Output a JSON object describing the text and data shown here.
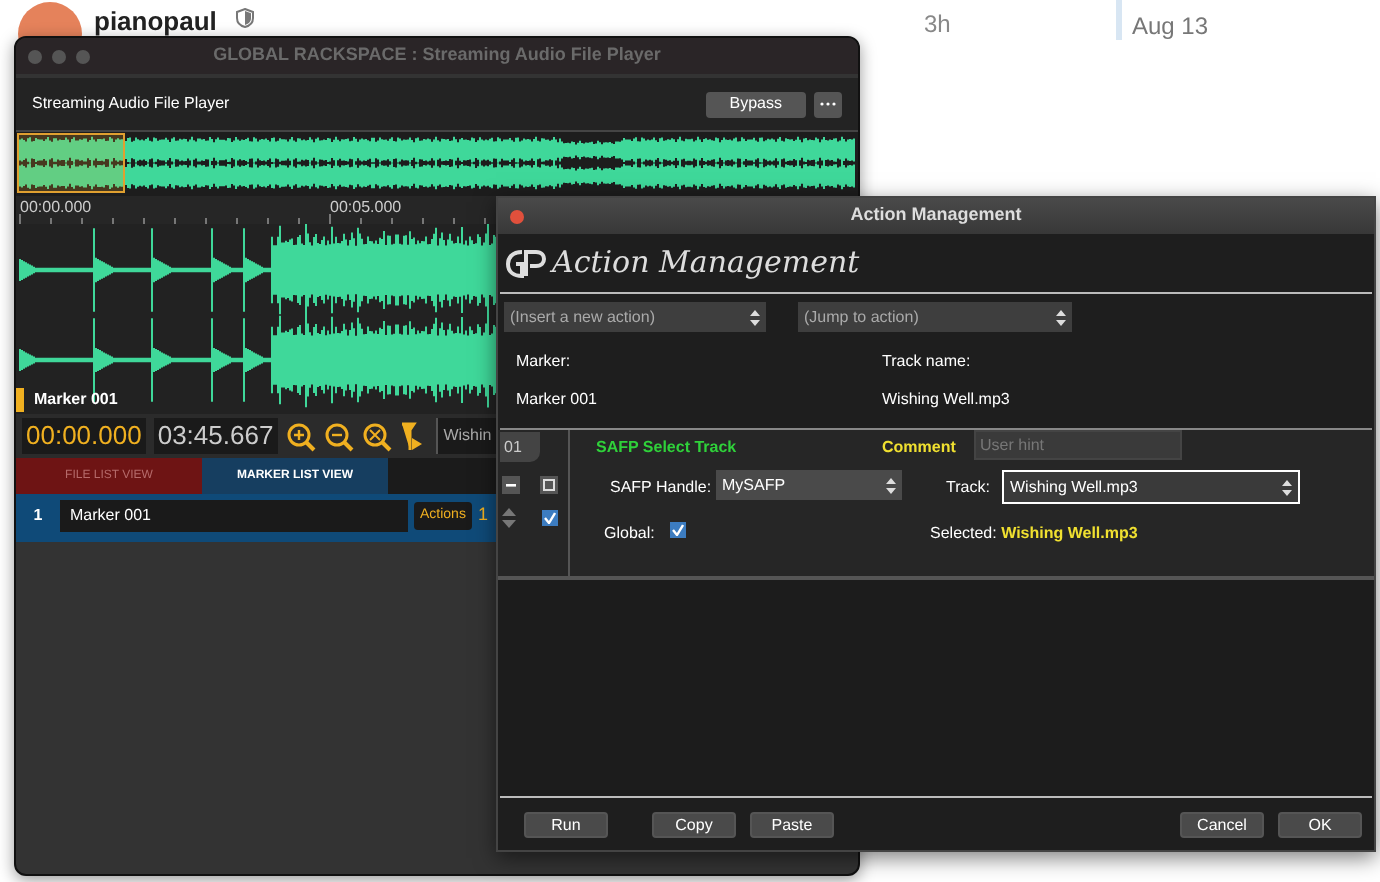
{
  "forum": {
    "username": "pianopaul",
    "time": "3h",
    "date": "Aug 13"
  },
  "main_window": {
    "title": "GLOBAL RACKSPACE : Streaming Audio File Player",
    "plugin_name": "Streaming Audio File Player",
    "bypass_button": "Bypass",
    "ruler_labels": [
      "00:00.000",
      "00:05.000"
    ],
    "marker_label": "Marker 001",
    "position_time": "00:00.000",
    "length_time": "03:45.667",
    "track_field": "Wishin",
    "tabs": [
      {
        "label": "FILE LIST VIEW",
        "selected": false
      },
      {
        "label": "MARKER LIST VIEW",
        "selected": true
      }
    ],
    "markers": [
      {
        "number": "1",
        "name": "Marker 001",
        "actions_button": "Actions",
        "action_count": "1"
      }
    ]
  },
  "dialog": {
    "title": "Action Management",
    "logo_text": "Action Management",
    "insert_dropdown": "(Insert a new action)",
    "jump_dropdown": "(Jump to action)",
    "marker_label": "Marker:",
    "marker_value": "Marker 001",
    "track_name_label": "Track name:",
    "track_name_value": "Wishing Well.mp3",
    "actions": [
      {
        "index": "01",
        "name": "SAFP Select Track",
        "comment_label": "Comment",
        "comment_placeholder": "User hint",
        "handle_label": "SAFP Handle:",
        "handle_value": "MySAFP",
        "track_label": "Track:",
        "track_value": "Wishing Well.mp3",
        "enabled": true,
        "global_label": "Global:",
        "global": true,
        "selected_label": "Selected:",
        "selected_value": "Wishing Well.mp3"
      }
    ],
    "buttons": [
      "Run",
      "Copy",
      "Paste",
      "Cancel",
      "OK"
    ]
  }
}
